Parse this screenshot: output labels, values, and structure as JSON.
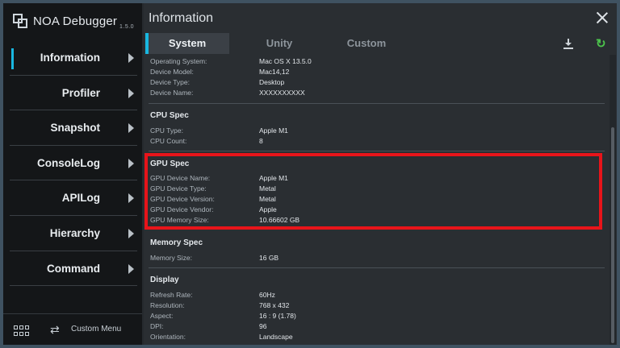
{
  "app": {
    "name": "NOA Debugger",
    "version": "1.5.0"
  },
  "sidebar": {
    "items": [
      {
        "label": "Information"
      },
      {
        "label": "Profiler"
      },
      {
        "label": "Snapshot"
      },
      {
        "label": "ConsoleLog"
      },
      {
        "label": "APILog"
      },
      {
        "label": "Hierarchy"
      },
      {
        "label": "Command"
      }
    ],
    "footer": {
      "custom_menu_label": "Custom Menu"
    }
  },
  "header": {
    "title": "Information"
  },
  "tabs": [
    {
      "label": "System"
    },
    {
      "label": "Unity"
    },
    {
      "label": "Custom"
    }
  ],
  "device": {
    "rows": [
      {
        "key": "Operating System:",
        "value": "Mac OS X 13.5.0"
      },
      {
        "key": "Device Model:",
        "value": "Mac14,12"
      },
      {
        "key": "Device Type:",
        "value": "Desktop"
      },
      {
        "key": "Device Name:",
        "value": "XXXXXXXXXX"
      }
    ]
  },
  "cpu": {
    "title": "CPU Spec",
    "rows": [
      {
        "key": "CPU Type:",
        "value": "Apple M1"
      },
      {
        "key": "CPU Count:",
        "value": "8"
      }
    ]
  },
  "gpu": {
    "title": "GPU Spec",
    "rows": [
      {
        "key": "GPU Device Name:",
        "value": "Apple M1"
      },
      {
        "key": "GPU Device Type:",
        "value": "Metal"
      },
      {
        "key": "GPU Device Version:",
        "value": "Metal"
      },
      {
        "key": "GPU Device Vendor:",
        "value": "Apple"
      },
      {
        "key": "GPU Memory Size:",
        "value": "10.66602 GB"
      }
    ]
  },
  "memory": {
    "title": "Memory Spec",
    "rows": [
      {
        "key": "Memory Size:",
        "value": "16 GB"
      }
    ]
  },
  "display": {
    "title": "Display",
    "rows": [
      {
        "key": "Refresh Rate:",
        "value": "60Hz"
      },
      {
        "key": "Resolution:",
        "value": "768 x 432"
      },
      {
        "key": "Aspect:",
        "value": "16 : 9 (1.78)"
      },
      {
        "key": "DPI:",
        "value": "96"
      },
      {
        "key": "Orientation:",
        "value": "Landscape"
      }
    ]
  },
  "colors": {
    "accent": "#19b7e0",
    "highlight": "#e8141a",
    "refresh": "#4cc44c"
  }
}
